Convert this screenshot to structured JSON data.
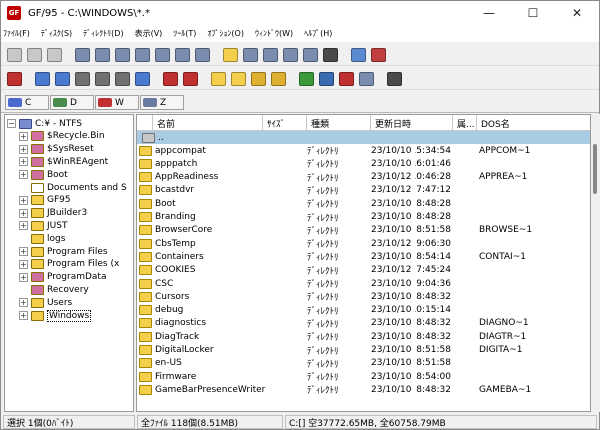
{
  "window": {
    "title": "GF/95 - C:\\WINDOWS\\*.*",
    "app_badge": "GF",
    "minimize_glyph": "—",
    "maximize_glyph": "☐",
    "close_glyph": "✕"
  },
  "menu": [
    "ﾌｧｲﾙ(F)",
    "ﾃﾞｨｽｸ(S)",
    "ﾃﾞｨﾚｸﾄﾘ(D)",
    "表示(V)",
    "ﾂｰﾙ(T)",
    "ｵﾌﾟｼｮﾝ(O)",
    "ｳｨﾝﾄﾞｳ(W)",
    "ﾍﾙﾌﾟ(H)"
  ],
  "toolbar1": [
    {
      "name": "copy-disabled-icon",
      "color": "#c8c8c8"
    },
    {
      "name": "clock-icon",
      "color": "#c8c8c8"
    },
    {
      "name": "new-disabled-icon",
      "color": "#c8c8c8"
    },
    {
      "sep": true
    },
    {
      "name": "sort-name-icon",
      "color": "#7a8cb0"
    },
    {
      "name": "sort-size-icon",
      "color": "#7a8cb0"
    },
    {
      "name": "sort-ext-icon",
      "color": "#7a8cb0"
    },
    {
      "name": "sort-date-icon",
      "color": "#7a8cb0"
    },
    {
      "name": "sort-type-icon",
      "color": "#7a8cb0"
    },
    {
      "name": "sort-attr-icon",
      "color": "#7a8cb0"
    },
    {
      "name": "sort-text-icon",
      "color": "#7a8cb0"
    },
    {
      "sep": true
    },
    {
      "name": "folder-open-icon",
      "color": "#f4cf4b"
    },
    {
      "name": "view-large-icon",
      "color": "#7a8cb0"
    },
    {
      "name": "view-small-icon",
      "color": "#7a8cb0"
    },
    {
      "name": "view-list-icon",
      "color": "#7a8cb0"
    },
    {
      "name": "view-detail-icon",
      "color": "#7a8cb0"
    },
    {
      "name": "view-grid-icon",
      "color": "#4a4a4a"
    },
    {
      "sep": true
    },
    {
      "name": "split-horizontal-icon",
      "color": "#5a8ad0"
    },
    {
      "name": "split-vertical-icon",
      "color": "#c04040"
    }
  ],
  "toolbar2": [
    {
      "name": "exit-icon",
      "color": "#c03030"
    },
    {
      "sep": true
    },
    {
      "name": "copy-icon",
      "color": "#4a7ad0"
    },
    {
      "name": "move-icon",
      "color": "#4a7ad0"
    },
    {
      "name": "delete-icon",
      "color": "#707070"
    },
    {
      "name": "rename-icon",
      "color": "#707070"
    },
    {
      "name": "attribute-icon",
      "color": "#707070"
    },
    {
      "name": "copy-to-icon",
      "color": "#4a7ad0"
    },
    {
      "sep": true
    },
    {
      "name": "compress-icon",
      "color": "#c03030"
    },
    {
      "name": "extract-icon",
      "color": "#c03030"
    },
    {
      "sep": true
    },
    {
      "name": "new-folder-icon",
      "color": "#f4cf4b"
    },
    {
      "name": "new-folder-yellow-icon",
      "color": "#f4cf4b"
    },
    {
      "name": "find-icon",
      "color": "#e0b030"
    },
    {
      "name": "key-icon",
      "color": "#e0b030"
    },
    {
      "sep": true
    },
    {
      "name": "edit-icon",
      "color": "#3a9a3a"
    },
    {
      "name": "book-icon",
      "color": "#3a6ab0"
    },
    {
      "name": "tape-icon",
      "color": "#c03030"
    },
    {
      "name": "info-icon",
      "color": "#7a8cb0"
    },
    {
      "sep": true
    },
    {
      "name": "help-icon",
      "color": "#4a4a4a"
    }
  ],
  "drives": [
    {
      "label": "C",
      "icon": "drive-c-icon",
      "color": "#4a6ad0"
    },
    {
      "label": "D",
      "icon": "drive-d-icon",
      "color": "#4a8a4a"
    },
    {
      "label": "W",
      "icon": "drive-w-icon",
      "color": "#c03030"
    },
    {
      "label": "Z",
      "icon": "drive-z-icon",
      "color": "#6a7aa0"
    }
  ],
  "tree": {
    "root_label": "C:¥ - NTFS",
    "items": [
      {
        "label": "$Recycle.Bin",
        "expander": "+",
        "color": "#d070a0"
      },
      {
        "label": "$SysReset",
        "expander": "+",
        "color": "#d070a0"
      },
      {
        "label": "$WinREAgent",
        "expander": "+",
        "color": "#d070a0"
      },
      {
        "label": "Boot",
        "expander": "+",
        "color": "#d070a0"
      },
      {
        "label": "Documents and S",
        "expander": "",
        "color": "#ffffff"
      },
      {
        "label": "GF95",
        "expander": "+",
        "color": "#f4cf4b"
      },
      {
        "label": "JBuilder3",
        "expander": "+",
        "color": "#f4cf4b"
      },
      {
        "label": "JUST",
        "expander": "+",
        "color": "#f4cf4b"
      },
      {
        "label": "logs",
        "expander": "",
        "color": "#f4cf4b"
      },
      {
        "label": "Program Files",
        "expander": "+",
        "color": "#f4cf4b"
      },
      {
        "label": "Program Files (x",
        "expander": "+",
        "color": "#f4cf4b"
      },
      {
        "label": "ProgramData",
        "expander": "+",
        "color": "#d070a0"
      },
      {
        "label": "Recovery",
        "expander": "",
        "color": "#d070a0"
      },
      {
        "label": "Users",
        "expander": "+",
        "color": "#f4cf4b"
      },
      {
        "label": "Windows",
        "expander": "+",
        "color": "#f4cf4b"
      }
    ]
  },
  "list": {
    "columns": [
      "",
      "名前",
      "ｻｲｽﾞ",
      "種類",
      "更新日時",
      "属...",
      "DOS名"
    ],
    "updir_label": "..",
    "rows": [
      {
        "name": "appcompat",
        "type": "ﾃﾞｨﾚｸﾄﾘ",
        "date": "23/10/10",
        "time": "15:34:54",
        "dos": "APPCOM~1"
      },
      {
        "name": "apppatch",
        "type": "ﾃﾞｨﾚｸﾄﾘ",
        "date": "23/10/10",
        "time": "16:01:46",
        "dos": ""
      },
      {
        "name": "AppReadiness",
        "type": "ﾃﾞｨﾚｸﾄﾘ",
        "date": "23/10/12",
        "time": "10:46:28",
        "dos": "APPREA~1"
      },
      {
        "name": "bcastdvr",
        "type": "ﾃﾞｨﾚｸﾄﾘ",
        "date": "23/10/12",
        "time": "7:47:12",
        "dos": ""
      },
      {
        "name": "Boot",
        "type": "ﾃﾞｨﾚｸﾄﾘ",
        "date": "23/10/10",
        "time": "8:48:28",
        "dos": ""
      },
      {
        "name": "Branding",
        "type": "ﾃﾞｨﾚｸﾄﾘ",
        "date": "23/10/10",
        "time": "8:48:28",
        "dos": ""
      },
      {
        "name": "BrowserCore",
        "type": "ﾃﾞｨﾚｸﾄﾘ",
        "date": "23/10/10",
        "time": "8:51:58",
        "dos": "BROWSE~1"
      },
      {
        "name": "CbsTemp",
        "type": "ﾃﾞｨﾚｸﾄﾘ",
        "date": "23/10/12",
        "time": "9:06:30",
        "dos": ""
      },
      {
        "name": "Containers",
        "type": "ﾃﾞｨﾚｸﾄﾘ",
        "date": "23/10/10",
        "time": "8:54:14",
        "dos": "CONTAI~1"
      },
      {
        "name": "COOKIES",
        "type": "ﾃﾞｨﾚｸﾄﾘ",
        "date": "23/10/12",
        "time": "7:45:24",
        "dos": ""
      },
      {
        "name": "CSC",
        "type": "ﾃﾞｨﾚｸﾄﾘ",
        "date": "23/10/10",
        "time": "9:04:36",
        "dos": ""
      },
      {
        "name": "Cursors",
        "type": "ﾃﾞｨﾚｸﾄﾘ",
        "date": "23/10/10",
        "time": "8:48:32",
        "dos": ""
      },
      {
        "name": "debug",
        "type": "ﾃﾞｨﾚｸﾄﾘ",
        "date": "23/10/10",
        "time": "10:15:14",
        "dos": ""
      },
      {
        "name": "diagnostics",
        "type": "ﾃﾞｨﾚｸﾄﾘ",
        "date": "23/10/10",
        "time": "8:48:32",
        "dos": "DIAGNO~1"
      },
      {
        "name": "DiagTrack",
        "type": "ﾃﾞｨﾚｸﾄﾘ",
        "date": "23/10/10",
        "time": "8:48:32",
        "dos": "DIAGTR~1"
      },
      {
        "name": "DigitalLocker",
        "type": "ﾃﾞｨﾚｸﾄﾘ",
        "date": "23/10/10",
        "time": "8:51:58",
        "dos": "DIGITA~1"
      },
      {
        "name": "en-US",
        "type": "ﾃﾞｨﾚｸﾄﾘ",
        "date": "23/10/10",
        "time": "8:51:58",
        "dos": ""
      },
      {
        "name": "Firmware",
        "type": "ﾃﾞｨﾚｸﾄﾘ",
        "date": "23/10/10",
        "time": "8:54:00",
        "dos": ""
      },
      {
        "name": "GameBarPresenceWriter",
        "type": "ﾃﾞｨﾚｸﾄﾘ",
        "date": "23/10/10",
        "time": "8:48:32",
        "dos": "GAMEBA~1"
      }
    ]
  },
  "status": {
    "selected": "選択 1個(0ﾊﾞｲﾄ)",
    "total": "全ﾌｧｲﾙ 118個(8.51MB)",
    "disk": "C:[] 空37772.65MB, 全60758.79MB"
  }
}
